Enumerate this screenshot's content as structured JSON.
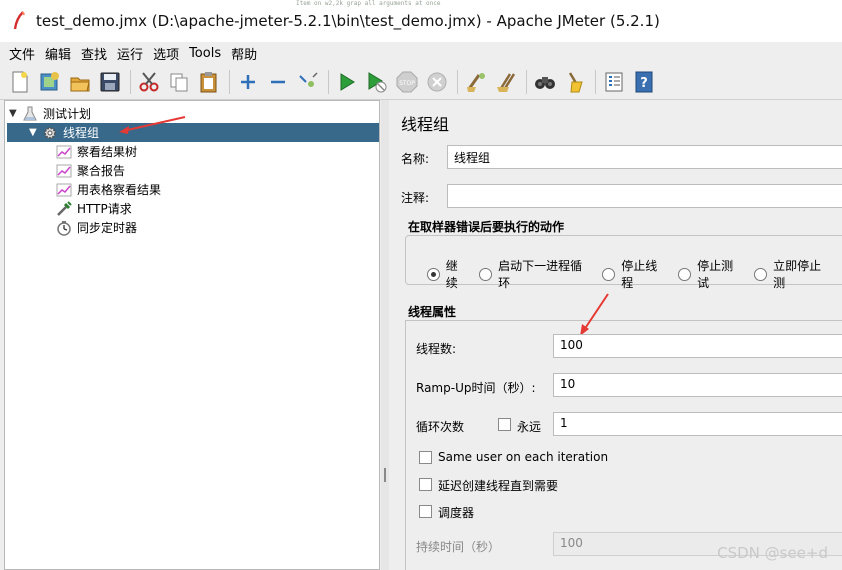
{
  "window": {
    "title": "test_demo.jmx (D:\\apache-jmeter-5.2.1\\bin\\test_demo.jmx) - Apache JMeter (5.2.1)",
    "ghost_text": "Item on w2,2k grap all arguments at once"
  },
  "menu": [
    "文件",
    "编辑",
    "查找",
    "运行",
    "选项",
    "Tools",
    "帮助"
  ],
  "toolbar": {
    "buttons": [
      "new-icon",
      "templates-icon",
      "open-icon",
      "save-icon",
      "cut-icon",
      "copy-icon",
      "paste-icon",
      "expand-icon",
      "collapse-icon",
      "toggle-icon",
      "start-icon",
      "start-no-pause-icon",
      "stop-icon",
      "shutdown-icon",
      "clear-icon",
      "clear-all-icon",
      "search-icon",
      "reset-search-icon",
      "function-helper-icon",
      "help-icon"
    ]
  },
  "tree": {
    "test_plan": "测试计划",
    "thread_group": "线程组",
    "children": [
      {
        "label": "察看结果树",
        "icon": "chart-icon"
      },
      {
        "label": "聚合报告",
        "icon": "chart-icon"
      },
      {
        "label": "用表格察看结果",
        "icon": "chart-icon"
      },
      {
        "label": "HTTP请求",
        "icon": "pipette-icon"
      },
      {
        "label": "同步定时器",
        "icon": "timer-icon"
      }
    ]
  },
  "panel": {
    "title": "线程组",
    "name_label": "名称:",
    "name_value": "线程组",
    "comment_label": "注释:",
    "comment_value": "",
    "error_action_title": "在取样器错误后要执行的动作",
    "error_actions": [
      {
        "label": "继续",
        "selected": true
      },
      {
        "label": "启动下一进程循环",
        "selected": false
      },
      {
        "label": "停止线程",
        "selected": false
      },
      {
        "label": "停止测试",
        "selected": false
      },
      {
        "label": "立即停止测",
        "selected": false
      }
    ],
    "thread_props_title": "线程属性",
    "threads_label": "线程数:",
    "threads_value": "100",
    "rampup_label": "Ramp-Up时间（秒）:",
    "rampup_value": "10",
    "loop_label": "循环次数",
    "forever_label": "永远",
    "loop_value": "1",
    "same_user_label": "Same user on each iteration",
    "delay_label": "延迟创建线程直到需要",
    "scheduler_label": "调度器",
    "duration_label": "持续时间（秒）",
    "duration_value": "100"
  },
  "watermark": "CSDN @see+d",
  "colors": {
    "selection": "#39698a",
    "annotation_arrow": "#e53935"
  }
}
